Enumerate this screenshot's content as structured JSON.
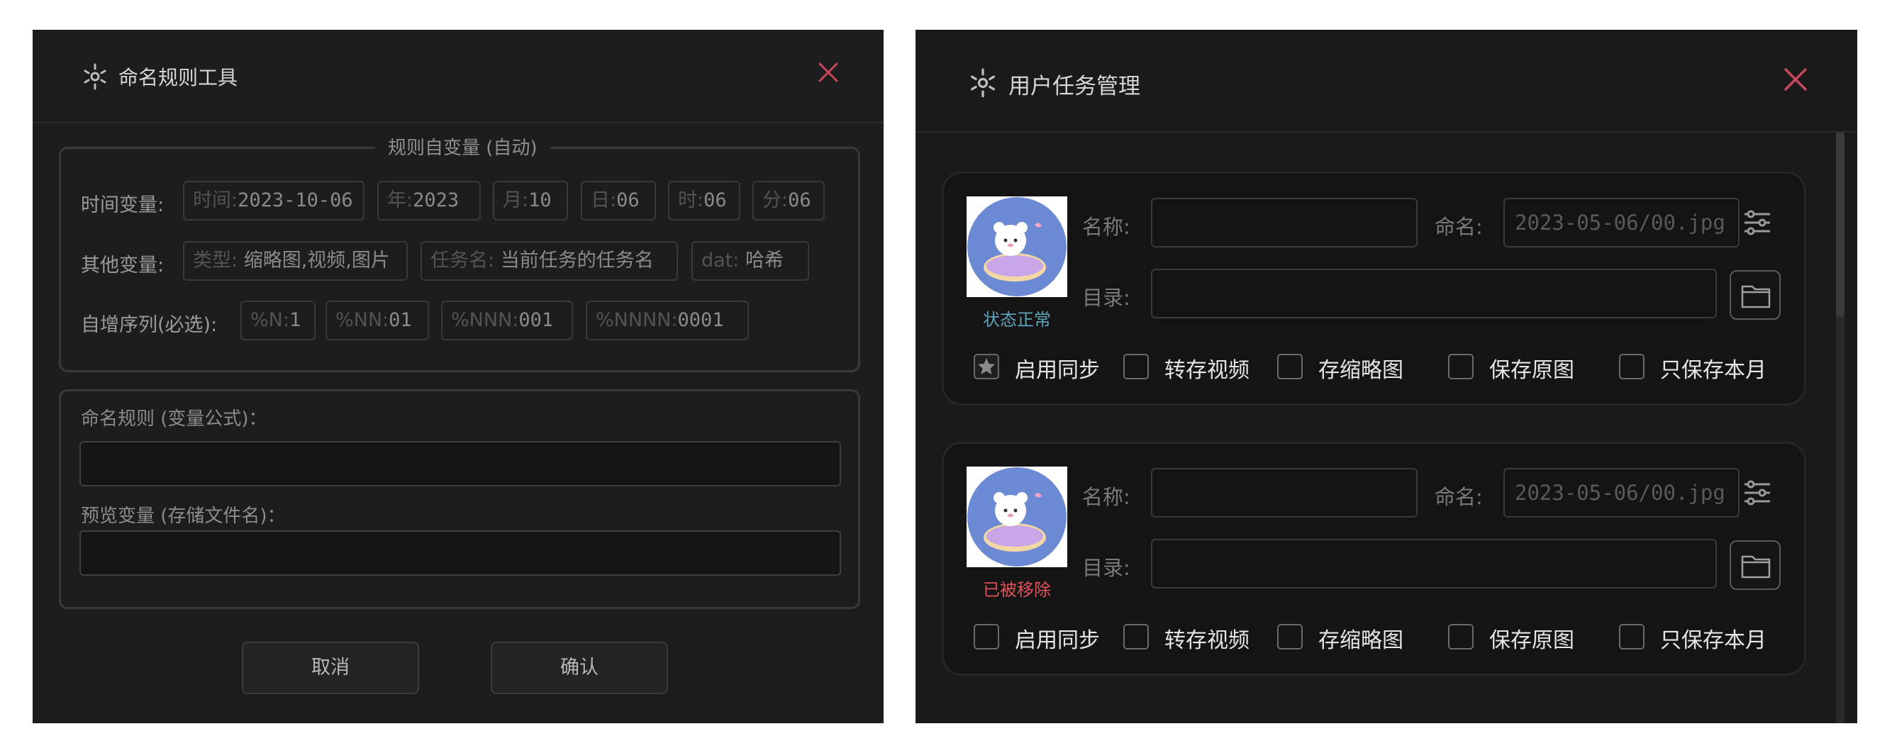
{
  "naming_tool": {
    "title": "命名规则工具",
    "vars_group_title": "规则自变量 (自动)",
    "time_row_label": "时间变量:",
    "time_chips": [
      {
        "key": "时间:",
        "value": "2023-10-06"
      },
      {
        "key": "年:",
        "value": "2023"
      },
      {
        "key": "月:",
        "value": "10"
      },
      {
        "key": "日:",
        "value": "06"
      },
      {
        "key": "时:",
        "value": "06"
      },
      {
        "key": "分:",
        "value": "06"
      }
    ],
    "other_row_label": "其他变量:",
    "other_chips": [
      {
        "key": "类型:",
        "value": "缩略图,视频,图片"
      },
      {
        "key": "任务名:",
        "value": "当前任务的任务名"
      },
      {
        "key": "dat:",
        "value": "哈希"
      }
    ],
    "seq_row_label": "自增序列(必选):",
    "seq_chips": [
      {
        "key": "%N:",
        "value": "1"
      },
      {
        "key": "%NN:",
        "value": "01"
      },
      {
        "key": "%NNN:",
        "value": "001"
      },
      {
        "key": "%NNNN:",
        "value": "0001"
      }
    ],
    "rule_label": "命名规则 (变量公式)：",
    "rule_value": "",
    "preview_label": "预览变量 (存储文件名)：",
    "preview_value": "",
    "cancel_label": "取消",
    "confirm_label": "确认"
  },
  "task_manager": {
    "title": "用户任务管理",
    "cards": [
      {
        "status": "状态正常",
        "status_color": "#5ea3b8",
        "name_label": "名称:",
        "name_value": "",
        "filename_label": "命名:",
        "filename_value": "2023-05-06/00.jpg",
        "dir_label": "目录:",
        "dir_value": "",
        "options": [
          {
            "label": "启用同步",
            "checked": true
          },
          {
            "label": "转存视频",
            "checked": false
          },
          {
            "label": "存缩略图",
            "checked": false
          },
          {
            "label": "保存原图",
            "checked": false
          },
          {
            "label": "只保存本月",
            "checked": false
          }
        ]
      },
      {
        "status": "已被移除",
        "status_color": "#e0525a",
        "name_label": "名称:",
        "name_value": "",
        "filename_label": "命名:",
        "filename_value": "2023-05-06/00.jpg",
        "dir_label": "目录:",
        "dir_value": "",
        "options": [
          {
            "label": "启用同步",
            "checked": false
          },
          {
            "label": "转存视频",
            "checked": false
          },
          {
            "label": "存缩略图",
            "checked": false
          },
          {
            "label": "保存原图",
            "checked": false
          },
          {
            "label": "只保存本月",
            "checked": false
          }
        ]
      }
    ]
  },
  "colors": {
    "close_icon": "#c9465f",
    "avatar_bg": "#6b8ad3"
  }
}
